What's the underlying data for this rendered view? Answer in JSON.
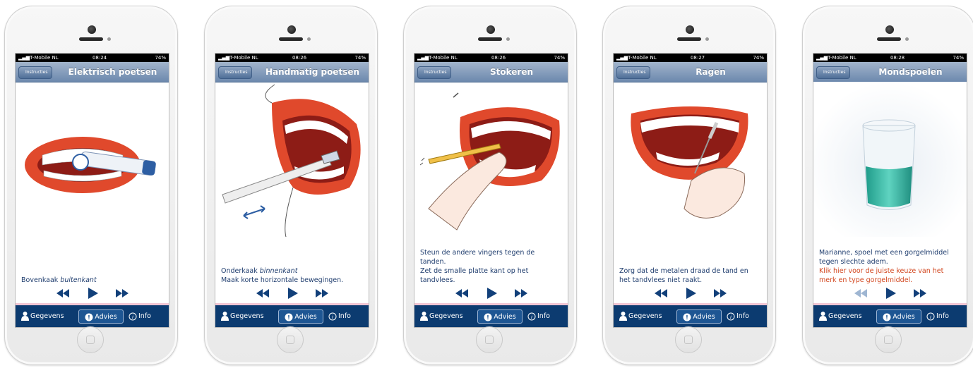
{
  "status": {
    "carrier": "T-Mobile NL",
    "battery": "74%"
  },
  "back_label": "Instructies",
  "tabs": {
    "gegevens": "Gegevens",
    "advies": "Advies",
    "info": "Info"
  },
  "colors": {
    "nav": "#7a93b6",
    "tabbar": "#0c3b70",
    "text": "#1f3d6e",
    "link": "#d2461e",
    "lips": "#e0492c"
  },
  "screens": [
    {
      "title": "Elektrisch poetsen",
      "time": "08:24",
      "cap1": "Bovenkaak ",
      "cap1_em": "buitenkant",
      "cap2": "",
      "cap3": "",
      "cap4": "",
      "red1": "",
      "red2": "",
      "illustration": "electric-toothbrush"
    },
    {
      "title": "Handmatig poetsen",
      "time": "08:26",
      "cap1": "Onderkaak ",
      "cap1_em": "binnenkant",
      "cap2": "Maak korte horizontale bewegingen.",
      "cap3": "",
      "cap4": "",
      "red1": "",
      "red2": "",
      "illustration": "manual-toothbrush"
    },
    {
      "title": "Stokeren",
      "time": "08:26",
      "cap1": "Steun de andere vingers tegen de",
      "cap1_em": "",
      "cap2": "tanden.",
      "cap3": "Zet de smalle platte kant op het",
      "cap4": "tandvlees.",
      "red1": "",
      "red2": "",
      "illustration": "toothpick"
    },
    {
      "title": "Ragen",
      "time": "08:27",
      "cap1": "Zorg dat de metalen draad de tand en",
      "cap1_em": "",
      "cap2": "het tandvlees niet raakt.",
      "cap3": "",
      "cap4": "",
      "red1": "",
      "red2": "",
      "illustration": "interdental-brush"
    },
    {
      "title": "Mondspoelen",
      "time": "08:28",
      "cap1": "Marianne, spoel met een gorgelmiddel",
      "cap1_em": "",
      "cap2": "tegen slechte adem.",
      "cap3": "",
      "cap4": "",
      "red1": "Klik hier voor de juiste keuze van het",
      "red2": "merk en type gorgelmiddel.",
      "illustration": "mouthwash-glass"
    }
  ]
}
